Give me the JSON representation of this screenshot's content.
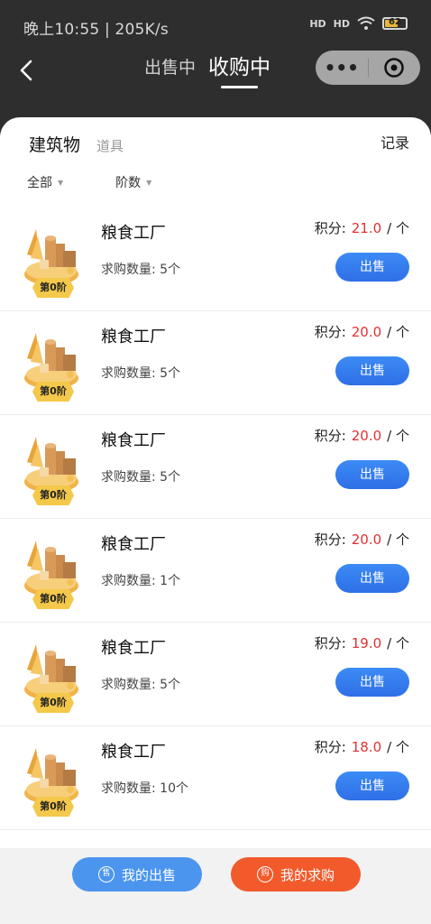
{
  "status_bar": {
    "time": "晚上10:55 | 205K/s",
    "signal1": "HD",
    "signal2": "HD",
    "battery": "62"
  },
  "nav": {
    "tabs": [
      {
        "label": "出售中",
        "active": false
      },
      {
        "label": "收购中",
        "active": true
      }
    ],
    "capsule_more": "•••"
  },
  "categories": {
    "tabs": [
      {
        "label": "建筑物",
        "active": true
      },
      {
        "label": "道具",
        "active": false
      }
    ],
    "record_label": "记录"
  },
  "filters": {
    "all_label": "全部",
    "tier_label": "阶数"
  },
  "items": [
    {
      "name": "粮食工厂",
      "badge": "第0阶",
      "qty_label": "求购数量: 5个",
      "points_label": "积分:",
      "points": "21.0",
      "unit": "/ 个",
      "button": "出售"
    },
    {
      "name": "粮食工厂",
      "badge": "第0阶",
      "qty_label": "求购数量: 5个",
      "points_label": "积分:",
      "points": "20.0",
      "unit": "/ 个",
      "button": "出售"
    },
    {
      "name": "粮食工厂",
      "badge": "第0阶",
      "qty_label": "求购数量: 5个",
      "points_label": "积分:",
      "points": "20.0",
      "unit": "/ 个",
      "button": "出售"
    },
    {
      "name": "粮食工厂",
      "badge": "第0阶",
      "qty_label": "求购数量: 1个",
      "points_label": "积分:",
      "points": "20.0",
      "unit": "/ 个",
      "button": "出售"
    },
    {
      "name": "粮食工厂",
      "badge": "第0阶",
      "qty_label": "求购数量: 5个",
      "points_label": "积分:",
      "points": "19.0",
      "unit": "/ 个",
      "button": "出售"
    },
    {
      "name": "粮食工厂",
      "badge": "第0阶",
      "qty_label": "求购数量: 10个",
      "points_label": "积分:",
      "points": "18.0",
      "unit": "/ 个",
      "button": "出售"
    }
  ],
  "bottom": {
    "my_sell_icon": "售",
    "my_sell_label": "我的出售",
    "my_buy_icon": "购",
    "my_buy_label": "我的求购"
  },
  "colors": {
    "accent_blue": "#2f6fe7",
    "price_red": "#e03131",
    "buy_orange": "#f25a2c"
  }
}
